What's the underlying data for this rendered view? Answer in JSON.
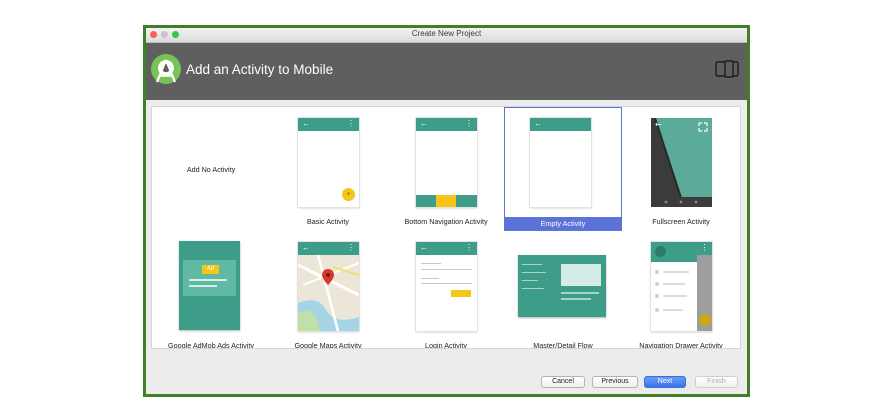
{
  "window": {
    "title": "Create New Project"
  },
  "header": {
    "title": "Add an Activity to Mobile"
  },
  "gallery": {
    "no_activity_label": "Add No Activity",
    "activities": [
      "Add No Activity",
      "Basic Activity",
      "Bottom Navigation Activity",
      "Empty Activity",
      "Fullscreen Activity",
      "Google AdMob Ads Activity",
      "Google Maps Activity",
      "Login Activity",
      "Master/Detail Flow",
      "Navigation Drawer Activity"
    ],
    "selected": "Empty Activity",
    "ad_badge": "Ad"
  },
  "glyphs": {
    "back": "←",
    "menu": "⋮",
    "fab_plus": "+"
  },
  "footer": {
    "cancel": "Cancel",
    "previous": "Previous",
    "next": "Next",
    "finish": "Finish"
  },
  "colors": {
    "accent": "#3d9d89",
    "selection": "#5b72d9",
    "frame": "#3f7f27",
    "fab": "#f5c518"
  }
}
